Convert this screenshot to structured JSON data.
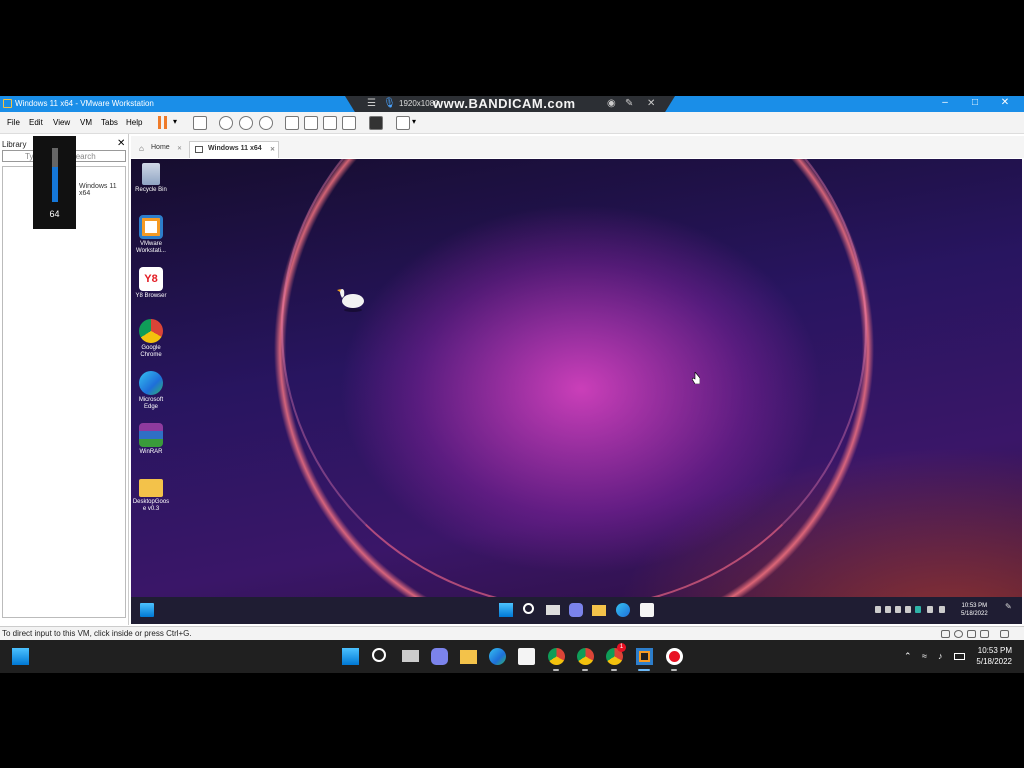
{
  "window": {
    "title": "Windows 11 x64 - VMware Workstation"
  },
  "overlay": {
    "resolution": "1920x1080",
    "watermark": "www.BANDICAM.com"
  },
  "menu": {
    "file": "File",
    "edit": "Edit",
    "view": "View",
    "vm": "VM",
    "tabs": "Tabs",
    "help": "Help"
  },
  "library": {
    "title": "Library",
    "search_placeholder": "Type here to search",
    "vm_item": "Windows 11 x64"
  },
  "volume": {
    "level": "64"
  },
  "tabs": {
    "home": "Home",
    "vm": "Windows 11 x64"
  },
  "desktop_icons": {
    "recycle": "Recycle Bin",
    "vmware": "VMware Workstati...",
    "y8": "Y8 Browser",
    "chrome": "Google Chrome",
    "edge": "Microsoft Edge",
    "winrar": "WinRAR",
    "folder": "DesktopGoos e v0.3"
  },
  "vm_clock": {
    "time": "10:53 PM",
    "date": "5/18/2022"
  },
  "status": {
    "message": "To direct input to this VM, click inside or press Ctrl+G."
  },
  "host_clock": {
    "time": "10:53 PM",
    "date": "5/18/2022"
  },
  "host_badge": "1",
  "colors": {
    "title_bar": "#1a8ee8",
    "pause_accent": "#ef7b2a",
    "taskbar": "#202020",
    "volume_fill": "#1577d8"
  },
  "volume_fraction": 0.64
}
